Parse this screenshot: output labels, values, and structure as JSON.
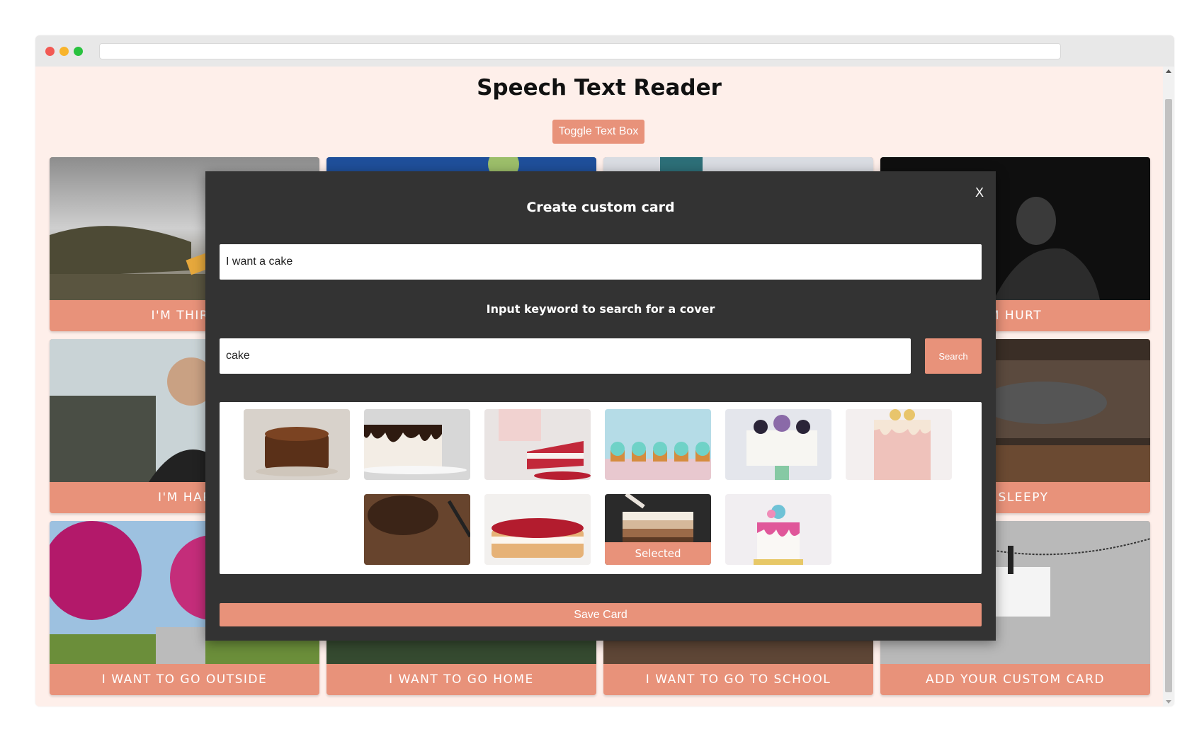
{
  "app": {
    "title": "Speech Text Reader",
    "toggle_label": "Toggle Text Box"
  },
  "cards": [
    {
      "label": "I'm thirsty",
      "visible_label": "I'M THIRS"
    },
    {
      "label": "",
      "visible_label": ""
    },
    {
      "label": "",
      "visible_label": ""
    },
    {
      "label": "I'm hurt",
      "visible_label": "M HURT"
    },
    {
      "label": "I'm happy",
      "visible_label": "I'M HAP"
    },
    {
      "label": "",
      "visible_label": ""
    },
    {
      "label": "",
      "visible_label": ""
    },
    {
      "label": "I'm sleepy",
      "visible_label": "M SLEEPY"
    },
    {
      "label": "I want to go outside",
      "visible_label": "I WANT TO GO OUTSIDE"
    },
    {
      "label": "I want to go home",
      "visible_label": "I WANT TO GO HOME"
    },
    {
      "label": "I want to go to school",
      "visible_label": "I WANT TO GO TO SCHOOL"
    },
    {
      "label": "Add your custom card",
      "visible_label": "ADD YOUR CUSTOM CARD"
    }
  ],
  "modal": {
    "close_label": "X",
    "title": "Create custom card",
    "text_value": "I want a cake",
    "keyword_label": "Input keyword to search for a cover",
    "keyword_value": "cake",
    "search_label": "Search",
    "selected_label": "Selected",
    "save_label": "Save Card",
    "results": [
      {
        "icon": "chocolate-cake-image"
      },
      {
        "icon": "drip-cake-image"
      },
      {
        "icon": "red-velvet-slice-image"
      },
      {
        "icon": "cupcakes-image"
      },
      {
        "icon": "berry-cake-image"
      },
      {
        "icon": "pink-drip-cake-image"
      },
      {
        "icon": "dark-cake-on-wood-image"
      },
      {
        "icon": "raspberry-cake-image"
      },
      {
        "icon": "ombre-cake-image",
        "selected": true
      },
      {
        "icon": "unicorn-cake-image"
      }
    ]
  },
  "colors": {
    "accent": "#e8927a",
    "page_background": "#feefea",
    "modal_background": "#333333"
  }
}
